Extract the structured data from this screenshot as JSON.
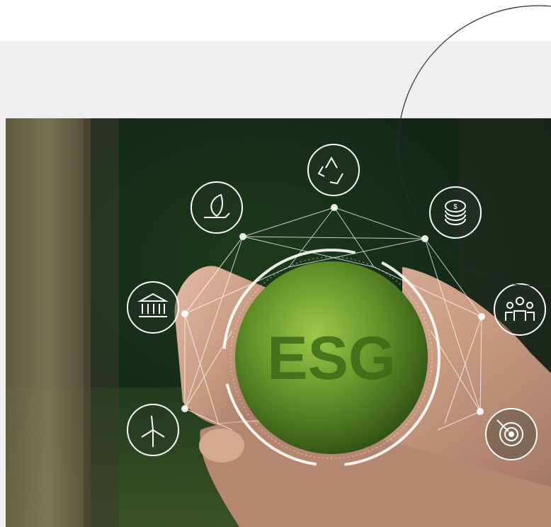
{
  "image": {
    "description_label": "",
    "sphere_text": "ESG",
    "icons": [
      {
        "name": "recycle-icon"
      },
      {
        "name": "eco-leaf-hand-icon"
      },
      {
        "name": "coin-stack-icon"
      },
      {
        "name": "bank-building-icon"
      },
      {
        "name": "community-people-icon"
      },
      {
        "name": "wind-turbine-icon"
      },
      {
        "name": "target-icon"
      }
    ]
  },
  "colors": {
    "band": "#efefef",
    "page": "#ffffff",
    "moss": "#6f9a2e",
    "network": "#ffffff"
  }
}
